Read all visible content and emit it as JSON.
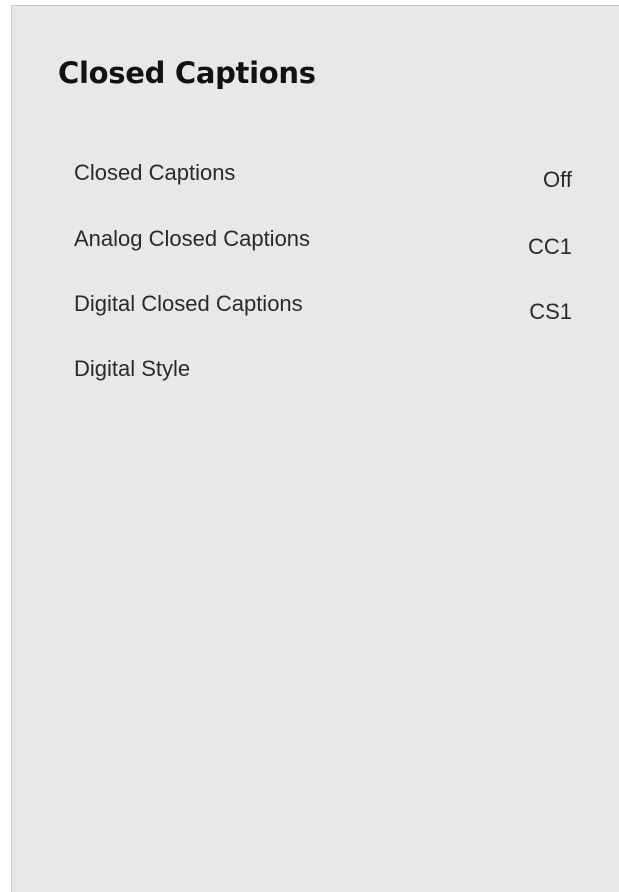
{
  "menu": {
    "title": "Closed Captions",
    "items": [
      {
        "label": "Closed Captions",
        "value": "Off"
      },
      {
        "label": "Analog Closed Captions",
        "value": "CC1"
      },
      {
        "label": "Digital Closed Captions",
        "value": "CS1"
      },
      {
        "label": "Digital Style",
        "value": ""
      }
    ]
  },
  "colors": {
    "panel_background": "#e8e8e8",
    "text": "#2a2a2a",
    "title": "#111111"
  }
}
